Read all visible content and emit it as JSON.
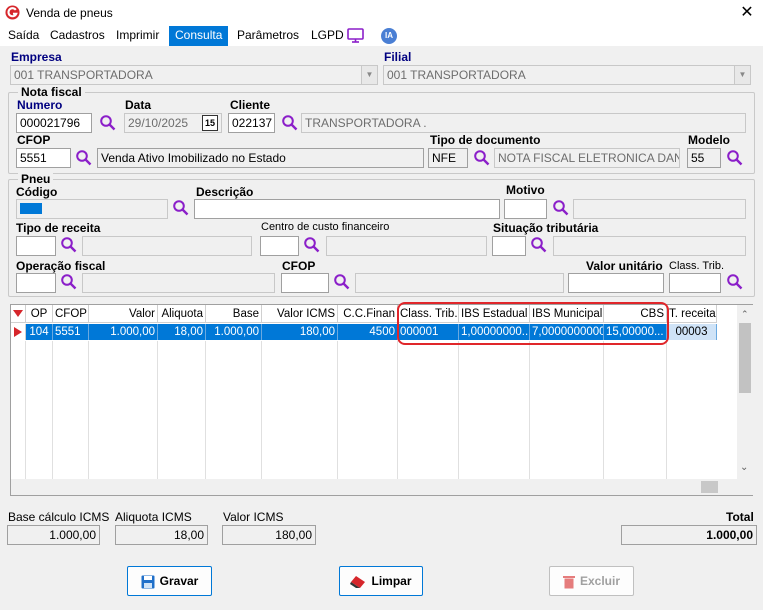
{
  "window": {
    "title": "Venda de pneus"
  },
  "menu": {
    "items": [
      "Saída",
      "Cadastros",
      "Imprimir",
      "Consulta",
      "Parâmetros",
      "LGPD"
    ],
    "ia_badge": "IA"
  },
  "empresa": {
    "label": "Empresa",
    "value": "001 TRANSPORTADORA"
  },
  "filial": {
    "label": "Filial",
    "value": "001 TRANSPORTADORA"
  },
  "nota": {
    "group_title": "Nota fiscal",
    "numero_label": "Numero",
    "numero_value": "000021796",
    "data_label": "Data",
    "data_value": "29/10/2025",
    "cal_day": "15",
    "cliente_label": "Cliente",
    "cliente_code": "022137",
    "cliente_name": "TRANSPORTADORA .",
    "cfop_label": "CFOP",
    "cfop_code": "5551",
    "cfop_desc": "Venda Ativo Imobilizado no Estado",
    "tipo_doc_label": "Tipo de documento",
    "tipo_doc_code": "NFE",
    "tipo_doc_desc": "NOTA FISCAL ELETRONICA DANFE",
    "modelo_label": "Modelo",
    "modelo_value": "55"
  },
  "pneu": {
    "group_title": "Pneu",
    "codigo_label": "Código",
    "descricao_label": "Descrição",
    "motivo_label": "Motivo",
    "tipo_receita_label": "Tipo de receita",
    "centro_custo_label": "Centro de custo financeiro",
    "situacao_label": "Situação tributária",
    "operacao_label": "Operação fiscal",
    "cfop_label": "CFOP",
    "valor_unit_label": "Valor unitário",
    "class_trib_label": "Class. Trib."
  },
  "grid": {
    "headers": [
      "OP",
      "CFOP",
      "Valor",
      "Aliquota",
      "Base",
      "Valor ICMS",
      "C.C.Finan",
      "Class. Trib.",
      "IBS Estadual",
      "IBS Municipal",
      "CBS",
      "T. receita"
    ],
    "row": [
      "104",
      "5551",
      "1.000,00",
      "18,00",
      "1.000,00",
      "180,00",
      "4500",
      "000001",
      "1,00000000...",
      "7,0000000000",
      "15,00000...",
      "00003"
    ],
    "highlight_color": "#e0262a"
  },
  "totals": {
    "base_label": "Base cálculo ICMS",
    "base_value": "1.000,00",
    "aliquota_label": "Aliquota ICMS",
    "aliquota_value": "18,00",
    "valor_label": "Valor ICMS",
    "valor_value": "180,00",
    "total_label": "Total",
    "total_value": "1.000,00"
  },
  "buttons": {
    "gravar": "Gravar",
    "limpar": "Limpar",
    "excluir": "Excluir"
  },
  "colors": {
    "accent": "#0078d7",
    "search_icon": "#8b1fc9",
    "logo": "#d6262b"
  }
}
